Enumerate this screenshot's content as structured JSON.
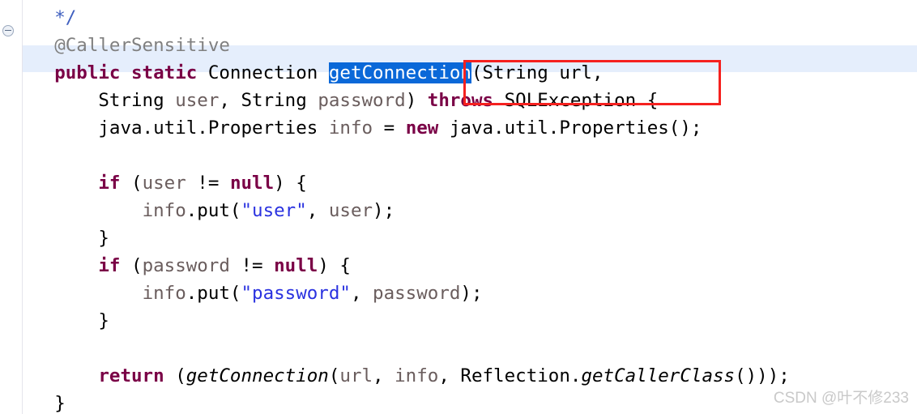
{
  "editor": {
    "language": "java",
    "file_kind": "source-code-viewer",
    "gutter": {
      "fold_marker": "collapse-fold-marker"
    },
    "current_line_index": 2,
    "colors": {
      "background": "#ffffff",
      "current_line_highlight": "#e5eefc",
      "selection_background": "#0a68d8",
      "selection_text": "#ffffff",
      "keyword": "#7a0046",
      "comment": "#3f5fbf",
      "annotation": "#808080",
      "parameter": "#6a5d5d",
      "string": "#2a32e0",
      "plain_text": "#000000",
      "annotation_box": "#f5211f",
      "watermark": "#c9c9c9"
    },
    "lines": [
      {
        "index": 0,
        "indent": "    ",
        "tokens": [
          {
            "text": "*/",
            "style": "cmt"
          }
        ]
      },
      {
        "index": 1,
        "indent": "    ",
        "tokens": [
          {
            "text": "@CallerSensitive",
            "style": "anno"
          }
        ]
      },
      {
        "index": 2,
        "indent": "    ",
        "tokens": [
          {
            "text": "public static",
            "style": "kw"
          },
          {
            "text": " ",
            "style": "plain"
          },
          {
            "text": "Connection",
            "style": "plain"
          },
          {
            "text": " ",
            "style": "plain"
          },
          {
            "text": "getConnection",
            "style": "sel"
          },
          {
            "text": "(String url,",
            "style": "plain"
          }
        ]
      },
      {
        "index": 3,
        "indent": "        ",
        "tokens": [
          {
            "text": "String ",
            "style": "plain"
          },
          {
            "text": "user",
            "style": "param"
          },
          {
            "text": ", String ",
            "style": "plain"
          },
          {
            "text": "password",
            "style": "param"
          },
          {
            "text": ") ",
            "style": "plain"
          },
          {
            "text": "throws",
            "style": "kw"
          },
          {
            "text": " SQLException {",
            "style": "plain"
          }
        ]
      },
      {
        "index": 4,
        "indent": "        ",
        "tokens": [
          {
            "text": "java.util.Properties ",
            "style": "plain"
          },
          {
            "text": "info",
            "style": "param"
          },
          {
            "text": " = ",
            "style": "plain"
          },
          {
            "text": "new",
            "style": "kw"
          },
          {
            "text": " java.util.Properties();",
            "style": "plain"
          }
        ]
      },
      {
        "index": 5,
        "indent": "",
        "tokens": []
      },
      {
        "index": 6,
        "indent": "        ",
        "tokens": [
          {
            "text": "if",
            "style": "kw"
          },
          {
            "text": " (",
            "style": "plain"
          },
          {
            "text": "user",
            "style": "param"
          },
          {
            "text": " != ",
            "style": "plain"
          },
          {
            "text": "null",
            "style": "kw"
          },
          {
            "text": ") {",
            "style": "plain"
          }
        ]
      },
      {
        "index": 7,
        "indent": "            ",
        "tokens": [
          {
            "text": "info",
            "style": "param"
          },
          {
            "text": ".put(",
            "style": "plain"
          },
          {
            "text": "\"user\"",
            "style": "str"
          },
          {
            "text": ", ",
            "style": "plain"
          },
          {
            "text": "user",
            "style": "param"
          },
          {
            "text": ");",
            "style": "plain"
          }
        ]
      },
      {
        "index": 8,
        "indent": "        ",
        "tokens": [
          {
            "text": "}",
            "style": "plain"
          }
        ]
      },
      {
        "index": 9,
        "indent": "        ",
        "tokens": [
          {
            "text": "if",
            "style": "kw"
          },
          {
            "text": " (",
            "style": "plain"
          },
          {
            "text": "password",
            "style": "param"
          },
          {
            "text": " != ",
            "style": "plain"
          },
          {
            "text": "null",
            "style": "kw"
          },
          {
            "text": ") {",
            "style": "plain"
          }
        ]
      },
      {
        "index": 10,
        "indent": "            ",
        "tokens": [
          {
            "text": "info",
            "style": "param"
          },
          {
            "text": ".put(",
            "style": "plain"
          },
          {
            "text": "\"password\"",
            "style": "str"
          },
          {
            "text": ", ",
            "style": "plain"
          },
          {
            "text": "password",
            "style": "param"
          },
          {
            "text": ");",
            "style": "plain"
          }
        ]
      },
      {
        "index": 11,
        "indent": "        ",
        "tokens": [
          {
            "text": "}",
            "style": "plain"
          }
        ]
      },
      {
        "index": 12,
        "indent": "",
        "tokens": []
      },
      {
        "index": 13,
        "indent": "        ",
        "tokens": [
          {
            "text": "return",
            "style": "kw"
          },
          {
            "text": " (",
            "style": "plain"
          },
          {
            "text": "getConnection",
            "style": "ital"
          },
          {
            "text": "(",
            "style": "plain"
          },
          {
            "text": "url",
            "style": "param"
          },
          {
            "text": ", ",
            "style": "plain"
          },
          {
            "text": "info",
            "style": "param"
          },
          {
            "text": ", Reflection.",
            "style": "plain"
          },
          {
            "text": "getCallerClass",
            "style": "ital"
          },
          {
            "text": "()));",
            "style": "plain"
          }
        ]
      },
      {
        "index": 14,
        "indent": "    ",
        "tokens": [
          {
            "text": "}",
            "style": "plain"
          }
        ]
      }
    ],
    "selection": {
      "text": "getConnection",
      "line_index": 2
    },
    "annotation_box": {
      "label": "red-highlight-rectangle",
      "encloses": "throws SQLException"
    }
  },
  "watermark": {
    "text": "CSDN @叶不修233"
  }
}
